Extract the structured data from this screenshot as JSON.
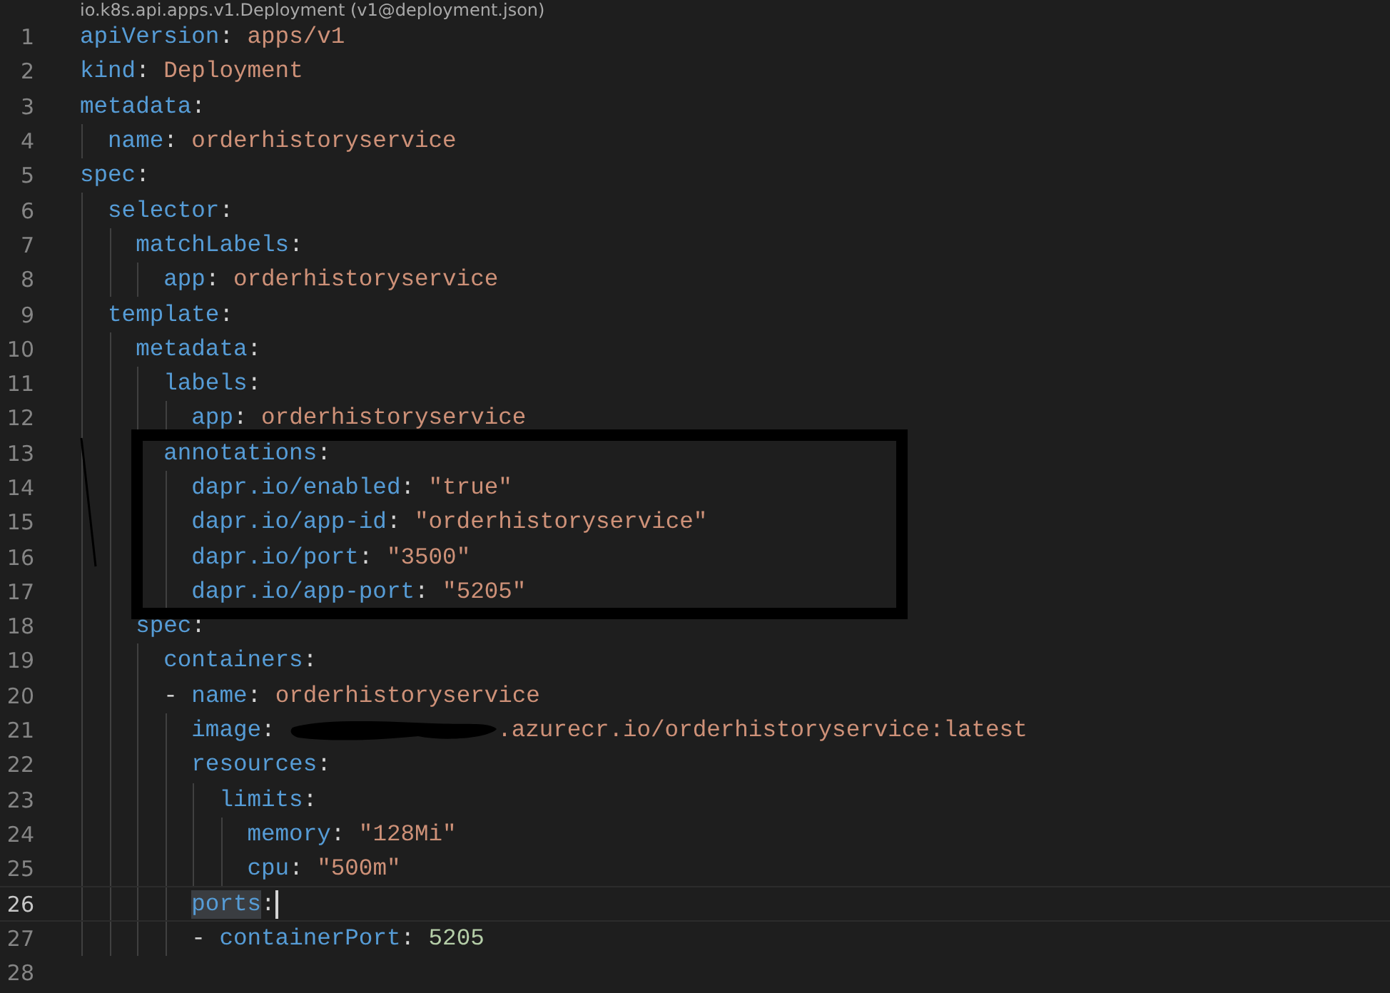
{
  "breadcrumb": "io.k8s.api.apps.v1.Deployment (v1@deployment.json)",
  "lines": [
    {
      "number": "1",
      "current": false,
      "boxed": false,
      "tokens": [
        {
          "kind": "key",
          "text": "apiVersion"
        },
        {
          "kind": "punct",
          "text": ": "
        },
        {
          "kind": "string",
          "text": "apps/v1"
        }
      ]
    },
    {
      "number": "2",
      "current": false,
      "boxed": false,
      "tokens": [
        {
          "kind": "key",
          "text": "kind"
        },
        {
          "kind": "punct",
          "text": ": "
        },
        {
          "kind": "string",
          "text": "Deployment"
        }
      ]
    },
    {
      "number": "3",
      "current": false,
      "boxed": false,
      "tokens": [
        {
          "kind": "key",
          "text": "metadata"
        },
        {
          "kind": "punct",
          "text": ":"
        }
      ]
    },
    {
      "number": "4",
      "current": false,
      "boxed": false,
      "tokens": [
        {
          "kind": "key",
          "text": "  name"
        },
        {
          "kind": "punct",
          "text": ": "
        },
        {
          "kind": "string",
          "text": "orderhistoryservice"
        }
      ]
    },
    {
      "number": "5",
      "current": false,
      "boxed": false,
      "tokens": [
        {
          "kind": "key",
          "text": "spec"
        },
        {
          "kind": "punct",
          "text": ":"
        }
      ]
    },
    {
      "number": "6",
      "current": false,
      "boxed": false,
      "tokens": [
        {
          "kind": "key",
          "text": "  selector"
        },
        {
          "kind": "punct",
          "text": ":"
        }
      ]
    },
    {
      "number": "7",
      "current": false,
      "boxed": false,
      "tokens": [
        {
          "kind": "key",
          "text": "    matchLabels"
        },
        {
          "kind": "punct",
          "text": ":"
        }
      ]
    },
    {
      "number": "8",
      "current": false,
      "boxed": false,
      "tokens": [
        {
          "kind": "key",
          "text": "      app"
        },
        {
          "kind": "punct",
          "text": ": "
        },
        {
          "kind": "string",
          "text": "orderhistoryservice"
        }
      ]
    },
    {
      "number": "9",
      "current": false,
      "boxed": false,
      "tokens": [
        {
          "kind": "key",
          "text": "  template"
        },
        {
          "kind": "punct",
          "text": ":"
        }
      ]
    },
    {
      "number": "10",
      "current": false,
      "boxed": false,
      "tokens": [
        {
          "kind": "key",
          "text": "    metadata"
        },
        {
          "kind": "punct",
          "text": ":"
        }
      ]
    },
    {
      "number": "11",
      "current": false,
      "boxed": false,
      "tokens": [
        {
          "kind": "key",
          "text": "      labels"
        },
        {
          "kind": "punct",
          "text": ":"
        }
      ]
    },
    {
      "number": "12",
      "current": false,
      "boxed": false,
      "tokens": [
        {
          "kind": "key",
          "text": "        app"
        },
        {
          "kind": "punct",
          "text": ": "
        },
        {
          "kind": "string",
          "text": "orderhistoryservice"
        }
      ]
    },
    {
      "number": "13",
      "current": false,
      "boxed": true,
      "tokens": [
        {
          "kind": "key",
          "text": "      annotations"
        },
        {
          "kind": "punct",
          "text": ":"
        }
      ]
    },
    {
      "number": "14",
      "current": false,
      "boxed": true,
      "tokens": [
        {
          "kind": "key",
          "text": "        dapr.io/enabled"
        },
        {
          "kind": "punct",
          "text": ": "
        },
        {
          "kind": "string",
          "text": "\"true\""
        }
      ]
    },
    {
      "number": "15",
      "current": false,
      "boxed": true,
      "tokens": [
        {
          "kind": "key",
          "text": "        dapr.io/app-id"
        },
        {
          "kind": "punct",
          "text": ": "
        },
        {
          "kind": "string",
          "text": "\"orderhistoryservice\""
        }
      ]
    },
    {
      "number": "16",
      "current": false,
      "boxed": true,
      "tokens": [
        {
          "kind": "key",
          "text": "        dapr.io/port"
        },
        {
          "kind": "punct",
          "text": ": "
        },
        {
          "kind": "string",
          "text": "\"3500\""
        }
      ]
    },
    {
      "number": "17",
      "current": false,
      "boxed": true,
      "tokens": [
        {
          "kind": "key",
          "text": "        dapr.io/app-port"
        },
        {
          "kind": "punct",
          "text": ": "
        },
        {
          "kind": "string",
          "text": "\"5205\""
        }
      ]
    },
    {
      "number": "18",
      "current": false,
      "boxed": false,
      "tokens": [
        {
          "kind": "key",
          "text": "    spec"
        },
        {
          "kind": "punct",
          "text": ":"
        }
      ]
    },
    {
      "number": "19",
      "current": false,
      "boxed": false,
      "tokens": [
        {
          "kind": "key",
          "text": "      containers"
        },
        {
          "kind": "punct",
          "text": ":"
        }
      ]
    },
    {
      "number": "20",
      "current": false,
      "boxed": false,
      "tokens": [
        {
          "kind": "punct",
          "text": "      - "
        },
        {
          "kind": "key",
          "text": "name"
        },
        {
          "kind": "punct",
          "text": ": "
        },
        {
          "kind": "string",
          "text": "orderhistoryservice"
        }
      ]
    },
    {
      "number": "21",
      "current": false,
      "boxed": false,
      "tokens": [
        {
          "kind": "key",
          "text": "        image"
        },
        {
          "kind": "punct",
          "text": ": "
        },
        {
          "kind": "redacted"
        },
        {
          "kind": "string",
          "text": ".azurecr.io/orderhistoryservice:latest"
        }
      ]
    },
    {
      "number": "22",
      "current": false,
      "boxed": false,
      "tokens": [
        {
          "kind": "key",
          "text": "        resources"
        },
        {
          "kind": "punct",
          "text": ":"
        }
      ]
    },
    {
      "number": "23",
      "current": false,
      "boxed": false,
      "tokens": [
        {
          "kind": "key",
          "text": "          limits"
        },
        {
          "kind": "punct",
          "text": ":"
        }
      ]
    },
    {
      "number": "24",
      "current": false,
      "boxed": false,
      "tokens": [
        {
          "kind": "key",
          "text": "            memory"
        },
        {
          "kind": "punct",
          "text": ": "
        },
        {
          "kind": "string",
          "text": "\"128Mi\""
        }
      ]
    },
    {
      "number": "25",
      "current": false,
      "boxed": false,
      "tokens": [
        {
          "kind": "key",
          "text": "            cpu"
        },
        {
          "kind": "punct",
          "text": ": "
        },
        {
          "kind": "string",
          "text": "\"500m\""
        }
      ]
    },
    {
      "number": "26",
      "current": true,
      "boxed": false,
      "tokens": [
        {
          "kind": "key",
          "text": "        ports"
        },
        {
          "kind": "punct",
          "text": ":"
        }
      ]
    },
    {
      "number": "27",
      "current": false,
      "boxed": false,
      "tokens": [
        {
          "kind": "punct",
          "text": "        - "
        },
        {
          "kind": "key",
          "text": "containerPort"
        },
        {
          "kind": "punct",
          "text": ": "
        },
        {
          "kind": "number",
          "text": "5205"
        }
      ]
    },
    {
      "number": "28",
      "current": false,
      "boxed": false
    }
  ]
}
